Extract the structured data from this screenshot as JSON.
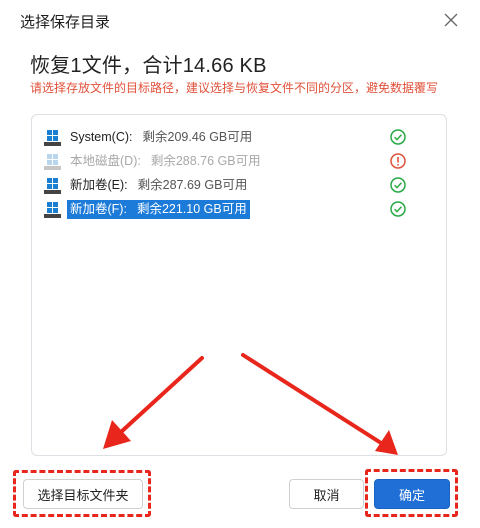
{
  "dialog": {
    "title": "选择保存目录",
    "headline": "恢复1文件，合计14.66 KB",
    "warning": "请选择存放文件的目标路径，建议选择与恢复文件不同的分区，避免数据覆写"
  },
  "drives": [
    {
      "name": "System(C):",
      "free": "剩余209.46 GB可用",
      "status": "ok",
      "state": "normal"
    },
    {
      "name": "本地磁盘(D):",
      "free": "剩余288.76 GB可用",
      "status": "warning",
      "state": "disabled"
    },
    {
      "name": "新加卷(E):",
      "free": "剩余287.69 GB可用",
      "status": "ok",
      "state": "normal"
    },
    {
      "name": "新加卷(F):",
      "free": "剩余221.10 GB可用",
      "status": "ok",
      "state": "selected"
    }
  ],
  "buttons": {
    "browse": "选择目标文件夹",
    "cancel": "取消",
    "ok": "确定"
  },
  "icons": {
    "close": "close-icon",
    "drive": "windows-drive-icon",
    "ok_status": "check-circle-icon",
    "warn_status": "info-circle-icon"
  },
  "colors": {
    "accent": "#1f6fd6",
    "warning_text": "#e0513a",
    "ok_green": "#27a844",
    "annotation_red": "#e8261c"
  }
}
